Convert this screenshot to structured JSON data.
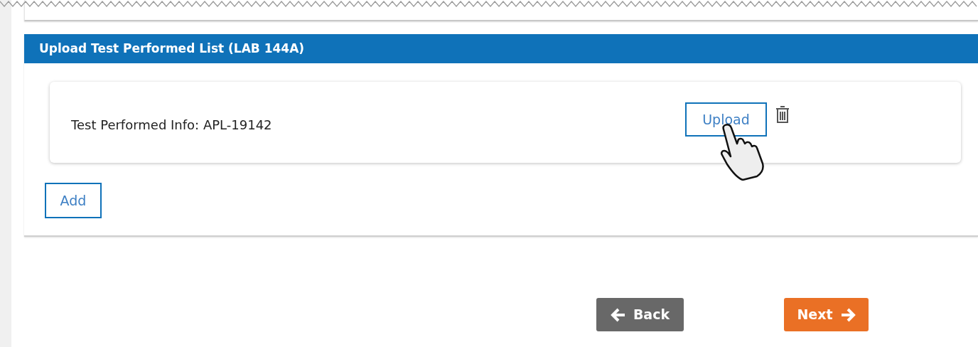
{
  "panel": {
    "title": "Upload Test Performed List (LAB 144A)",
    "items": [
      {
        "label": "Test Performed Info: APL-19142",
        "upload_button": "Upload"
      }
    ],
    "add_button": "Add"
  },
  "nav_buttons": [
    {
      "kind": "back",
      "label": "Back"
    },
    {
      "kind": "next",
      "label": "Next"
    }
  ]
}
